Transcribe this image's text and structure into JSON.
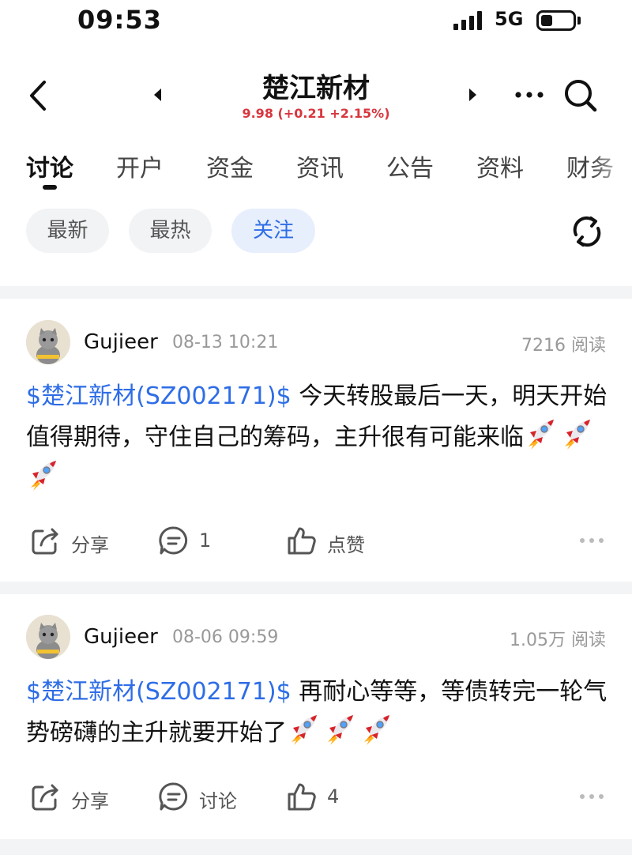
{
  "status_bar": {
    "time": "09:53",
    "network": "5G",
    "icons": [
      "signal-icon",
      "battery-icon"
    ]
  },
  "header": {
    "title": "楚江新材",
    "quote": "9.98 (+0.21 +2.15%)",
    "quote_color": "#d9363e",
    "icons": [
      "back-icon",
      "prev-stock-icon",
      "next-stock-icon",
      "more-icon",
      "search-icon"
    ]
  },
  "tabs": [
    {
      "label": "讨论",
      "active": true
    },
    {
      "label": "开户"
    },
    {
      "label": "资金"
    },
    {
      "label": "资讯"
    },
    {
      "label": "公告"
    },
    {
      "label": "资料"
    },
    {
      "label": "财务"
    }
  ],
  "filters": [
    {
      "label": "最新"
    },
    {
      "label": "最热"
    },
    {
      "label": "关注",
      "active": true
    }
  ],
  "accent_color": "#2e6de6",
  "posts": [
    {
      "username": "Gujieer",
      "time": "08-13 10:21",
      "reads": "7216 阅读",
      "stock_link": "$楚江新材(SZ002171)$",
      "text": " 今天转股最后一天，明天开始值得期待，守住自己的筹码，主升很有可能来临",
      "emoji": "rocket-icon ×3",
      "share_label": "分享",
      "comment_label": "1",
      "like_label": "点赞"
    },
    {
      "username": "Gujieer",
      "time": "08-06 09:59",
      "reads": "1.05万 阅读",
      "stock_link": "$楚江新材(SZ002171)$",
      "text": " 再耐心等等，等债转完一轮气势磅礴的主升就要开始了",
      "emoji": "rocket-icon ×3",
      "share_label": "分享",
      "comment_label": "讨论",
      "like_label": "4"
    }
  ]
}
